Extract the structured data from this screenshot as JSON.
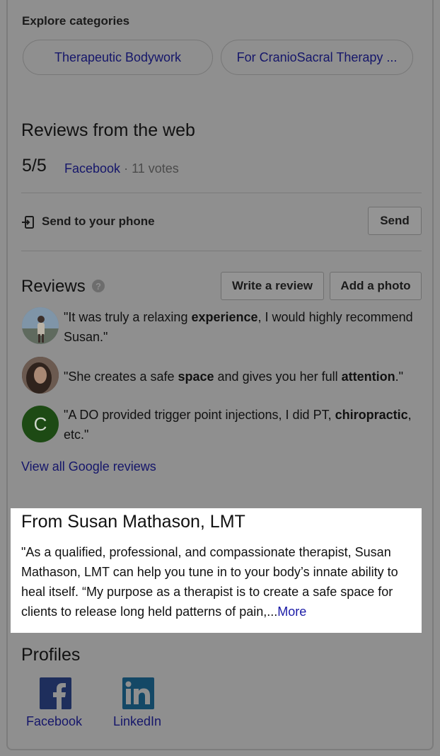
{
  "explore": {
    "heading": "Explore categories",
    "chips": [
      "Therapeutic Bodywork",
      "For CranioSacral Therapy ..."
    ]
  },
  "web_reviews": {
    "heading": "Reviews from the web",
    "score": "5/5",
    "source": "Facebook",
    "votes": "· 11 votes"
  },
  "send": {
    "label": "Send to your phone",
    "button": "Send",
    "icon": "send-to-phone-icon"
  },
  "reviews": {
    "heading": "Reviews",
    "help_glyph": "?",
    "write_button": "Write a review",
    "photo_button": "Add a photo",
    "view_all": "View all Google reviews",
    "items": [
      {
        "avatar": "photo",
        "parts": [
          "\"It was truly a relaxing ",
          "experience",
          ", I would highly recommend Susan.\""
        ]
      },
      {
        "avatar": "photo",
        "parts": [
          "\"She creates a safe ",
          "space",
          " and gives you her full ",
          "attention",
          ".\""
        ]
      },
      {
        "avatar_letter": "C",
        "avatar_color": "#1d4a14",
        "parts": [
          "\"A DO provided trigger point injections, I did PT, ",
          "chiropractic",
          ", etc.\""
        ]
      }
    ]
  },
  "from_business": {
    "title": "From Susan Mathason, LMT",
    "text": "\"As a qualified, professional, and compassionate therapist, Susan Mathason, LMT can help you tune in to your body’s innate ability to heal itself. “My purpose as a therapist is to create a safe space for clients to release long held patterns of pain,...",
    "more": "More"
  },
  "profiles": {
    "heading": "Profiles",
    "items": [
      {
        "label": "Facebook",
        "icon": "facebook-icon",
        "color": "#1e2e5c"
      },
      {
        "label": "LinkedIn",
        "icon": "linkedin-icon",
        "color": "#144866"
      }
    ]
  }
}
